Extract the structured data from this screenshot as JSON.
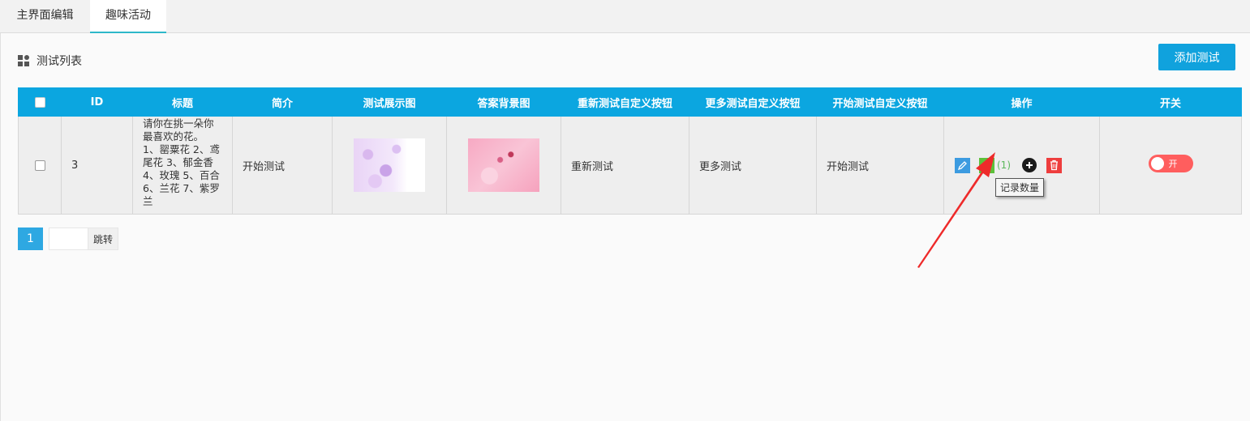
{
  "tabs": [
    {
      "label": "主界面编辑",
      "active": false
    },
    {
      "label": "趣味活动",
      "active": true
    }
  ],
  "section": {
    "title": "测试列表",
    "icon": "grid-icon"
  },
  "toolbar": {
    "add_label": "添加测试"
  },
  "table": {
    "columns": [
      "",
      "ID",
      "标题",
      "简介",
      "测试展示图",
      "答案背景图",
      "重新测试自定义按钮",
      "更多测试自定义按钮",
      "开始测试自定义按钮",
      "操作",
      "开关"
    ],
    "rows": [
      {
        "id": "3",
        "title": "请你在挑一朵你最喜欢的花。 1、罂粟花 2、鸢尾花 3、郁金香 4、玫瑰 5、百合 6、兰花 7、紫罗兰",
        "intro": "开始测试",
        "retest": "重新测试",
        "more": "更多测试",
        "start": "开始测试",
        "record_count": "(1)",
        "tooltip": "记录数量",
        "switch_label": "开"
      }
    ]
  },
  "pager": {
    "page": "1",
    "jump_label": "跳转"
  },
  "colors": {
    "header": "#0ba6e0",
    "accent": "#10a2dd",
    "switch": "#ff5e5e",
    "arrow": "#ee2a2a"
  }
}
